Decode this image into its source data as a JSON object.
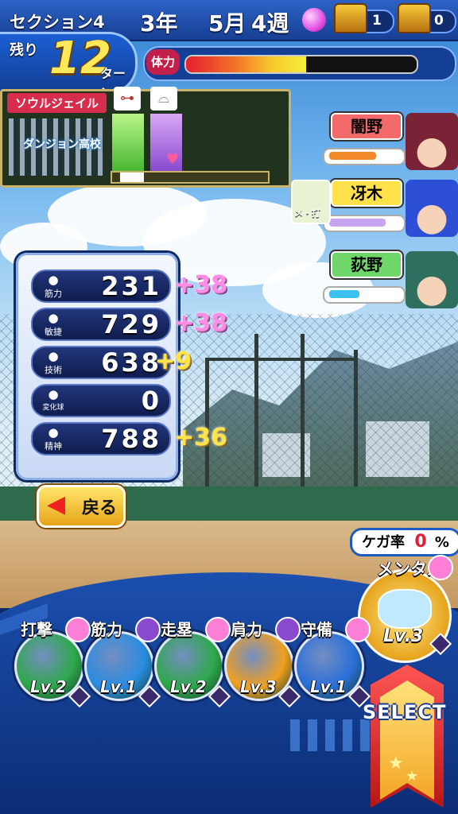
{
  "header": {
    "section_label": "セクション4",
    "grade": "3年",
    "month": "5月",
    "week": "4週",
    "chest1_count": "1",
    "chest2_count": "0"
  },
  "turns": {
    "remain_label": "残り",
    "value": "12",
    "unit": "ターン"
  },
  "stamina": {
    "label": "体力",
    "level": 0.52
  },
  "team": {
    "rival_label": "ソウルジェイル",
    "school_name": "ダンジョン高校"
  },
  "stats": [
    {
      "name": "筋力",
      "value": "231",
      "bonus": "+38",
      "bonus_color": "#ff8ce6",
      "icon": "dumbbell-icon"
    },
    {
      "name": "敏捷",
      "value": "729",
      "bonus": "+38",
      "bonus_color": "#ff8ce6",
      "icon": "shoe-icon"
    },
    {
      "name": "技術",
      "value": "638",
      "bonus": "+9",
      "bonus_color": "#ffe447",
      "icon": "bat-icon"
    },
    {
      "name": "変化球",
      "value": "0",
      "bonus": "",
      "bonus_color": "",
      "icon": "ball-icon"
    },
    {
      "name": "精神",
      "value": "788",
      "bonus": "+36",
      "bonus_color": "#ffe447",
      "icon": "spirit-icon"
    }
  ],
  "characters": [
    {
      "name": "闇野",
      "plate_color": "#f26a6a",
      "bar_color": "#f28a2a",
      "bar_level": 0.7
    },
    {
      "name": "冴木",
      "plate_color": "#ffe14a",
      "bar_color": "#c8a4f0",
      "bar_level": 0.85,
      "tag": "メ・打"
    },
    {
      "name": "荻野",
      "plate_color": "#6fd66a",
      "bar_color": "#3cc0f0",
      "bar_level": 0.45
    }
  ],
  "back_button": {
    "label": "戻る"
  },
  "injury": {
    "label": "ケガ率",
    "value": "0",
    "unit": "%"
  },
  "mental": {
    "label": "メンタル",
    "level": "Lv.3"
  },
  "practice": [
    {
      "label": "打撃",
      "level": "Lv.2",
      "color": "#2fa84a"
    },
    {
      "label": "筋力",
      "level": "Lv.1",
      "color": "#2a8ce0"
    },
    {
      "label": "走塁",
      "level": "Lv.2",
      "color": "#2fa84a"
    },
    {
      "label": "肩力",
      "level": "Lv.3",
      "color": "#f0a020"
    },
    {
      "label": "守備",
      "level": "Lv.1",
      "color": "#2a6fd8"
    }
  ],
  "select_button": {
    "label": "SELECT"
  }
}
